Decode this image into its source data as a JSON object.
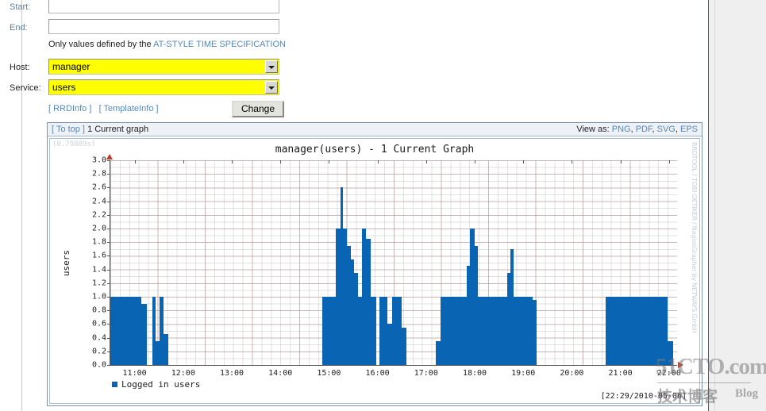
{
  "form": {
    "start": {
      "label": "Start:",
      "value": "",
      "placeholder": ""
    },
    "end": {
      "label": "End:",
      "value": "",
      "placeholder": ""
    },
    "note_prefix": "Only values defined by the",
    "note_link": "AT-STYLE TIME SPECIFICATION",
    "host": {
      "label": "Host:",
      "value": "manager"
    },
    "service": {
      "label": "Service:",
      "value": "users"
    },
    "rrdinfo_link": "[ RRDInfo ]",
    "templateinfo_link": "[ TemplateInfo ]",
    "change_button": "Change"
  },
  "graph_panel": {
    "to_top_link": "[ To top ]",
    "header_title": "1 Current graph",
    "view_as_label": "View as:",
    "view_as_options": [
      "PNG",
      "PDF",
      "SVG",
      "EPS"
    ],
    "render_time": "(0.79889s)",
    "vertical_credit": "RRDTOOL / TOBI OETIKER / NagiosGrapher by NETWAYS GmbH",
    "timestamp": "[22:29/2010-05-06]"
  },
  "watermark": {
    "main": "51CTO.com",
    "cn": "技术博客",
    "blog": "Blog"
  },
  "colors": {
    "bar": "#0a64b4",
    "link": "#5588bb",
    "select_bg": "#ffff00",
    "panel_border": "#7a93ab"
  },
  "chart_data": {
    "type": "area",
    "title": "manager(users) - 1 Current Graph",
    "xlabel": "",
    "ylabel": "users",
    "ylim": [
      0.0,
      3.0
    ],
    "ytick_step": 0.2,
    "yticks": [
      0.0,
      0.2,
      0.4,
      0.6,
      0.8,
      1.0,
      1.2,
      1.4,
      1.6,
      1.8,
      2.0,
      2.2,
      2.4,
      2.6,
      2.8,
      3.0
    ],
    "xlim": [
      "10:30",
      "22:10"
    ],
    "xticks": [
      "11:00",
      "12:00",
      "13:00",
      "14:00",
      "15:00",
      "16:00",
      "17:00",
      "18:00",
      "19:00",
      "20:00",
      "21:00",
      "22:00"
    ],
    "grid": true,
    "legend_position": "bottom-left",
    "series": [
      {
        "name": "Logged in users",
        "color": "#0a64b4",
        "unit": "users",
        "segments": [
          {
            "x0": "10:30",
            "x1": "11:08",
            "value": 1.0
          },
          {
            "x0": "11:08",
            "x1": "11:15",
            "value": 0.9
          },
          {
            "x0": "11:22",
            "x1": "11:26",
            "value": 1.0
          },
          {
            "x0": "11:26",
            "x1": "11:31",
            "value": 0.35
          },
          {
            "x0": "11:31",
            "x1": "11:36",
            "value": 1.0
          },
          {
            "x0": "11:36",
            "x1": "11:42",
            "value": 0.45
          },
          {
            "x0": "14:52",
            "x1": "15:08",
            "value": 1.0
          },
          {
            "x0": "15:08",
            "x1": "15:14",
            "value": 2.0
          },
          {
            "x0": "15:14",
            "x1": "15:17",
            "value": 2.6
          },
          {
            "x0": "15:17",
            "x1": "15:22",
            "value": 2.0
          },
          {
            "x0": "15:22",
            "x1": "15:27",
            "value": 1.75
          },
          {
            "x0": "15:27",
            "x1": "15:31",
            "value": 1.55
          },
          {
            "x0": "15:31",
            "x1": "15:36",
            "value": 1.35
          },
          {
            "x0": "15:36",
            "x1": "15:41",
            "value": 1.0
          },
          {
            "x0": "15:41",
            "x1": "15:46",
            "value": 2.0
          },
          {
            "x0": "15:46",
            "x1": "15:52",
            "value": 1.85
          },
          {
            "x0": "15:52",
            "x1": "15:58",
            "value": 1.0
          },
          {
            "x0": "16:02",
            "x1": "16:12",
            "value": 1.0
          },
          {
            "x0": "16:12",
            "x1": "16:18",
            "value": 0.6
          },
          {
            "x0": "16:18",
            "x1": "16:30",
            "value": 1.0
          },
          {
            "x0": "16:30",
            "x1": "16:36",
            "value": 0.55
          },
          {
            "x0": "17:12",
            "x1": "17:18",
            "value": 0.35
          },
          {
            "x0": "17:18",
            "x1": "17:50",
            "value": 1.0
          },
          {
            "x0": "17:50",
            "x1": "17:54",
            "value": 1.45
          },
          {
            "x0": "17:54",
            "x1": "18:00",
            "value": 2.0
          },
          {
            "x0": "18:00",
            "x1": "18:04",
            "value": 1.75
          },
          {
            "x0": "18:04",
            "x1": "18:40",
            "value": 1.0
          },
          {
            "x0": "18:40",
            "x1": "18:44",
            "value": 1.35
          },
          {
            "x0": "18:44",
            "x1": "18:48",
            "value": 1.7
          },
          {
            "x0": "18:48",
            "x1": "19:12",
            "value": 1.0
          },
          {
            "x0": "19:12",
            "x1": "19:16",
            "value": 0.95
          },
          {
            "x0": "20:42",
            "x1": "21:58",
            "value": 1.0
          },
          {
            "x0": "21:58",
            "x1": "22:05",
            "value": 0.35
          }
        ]
      }
    ]
  }
}
